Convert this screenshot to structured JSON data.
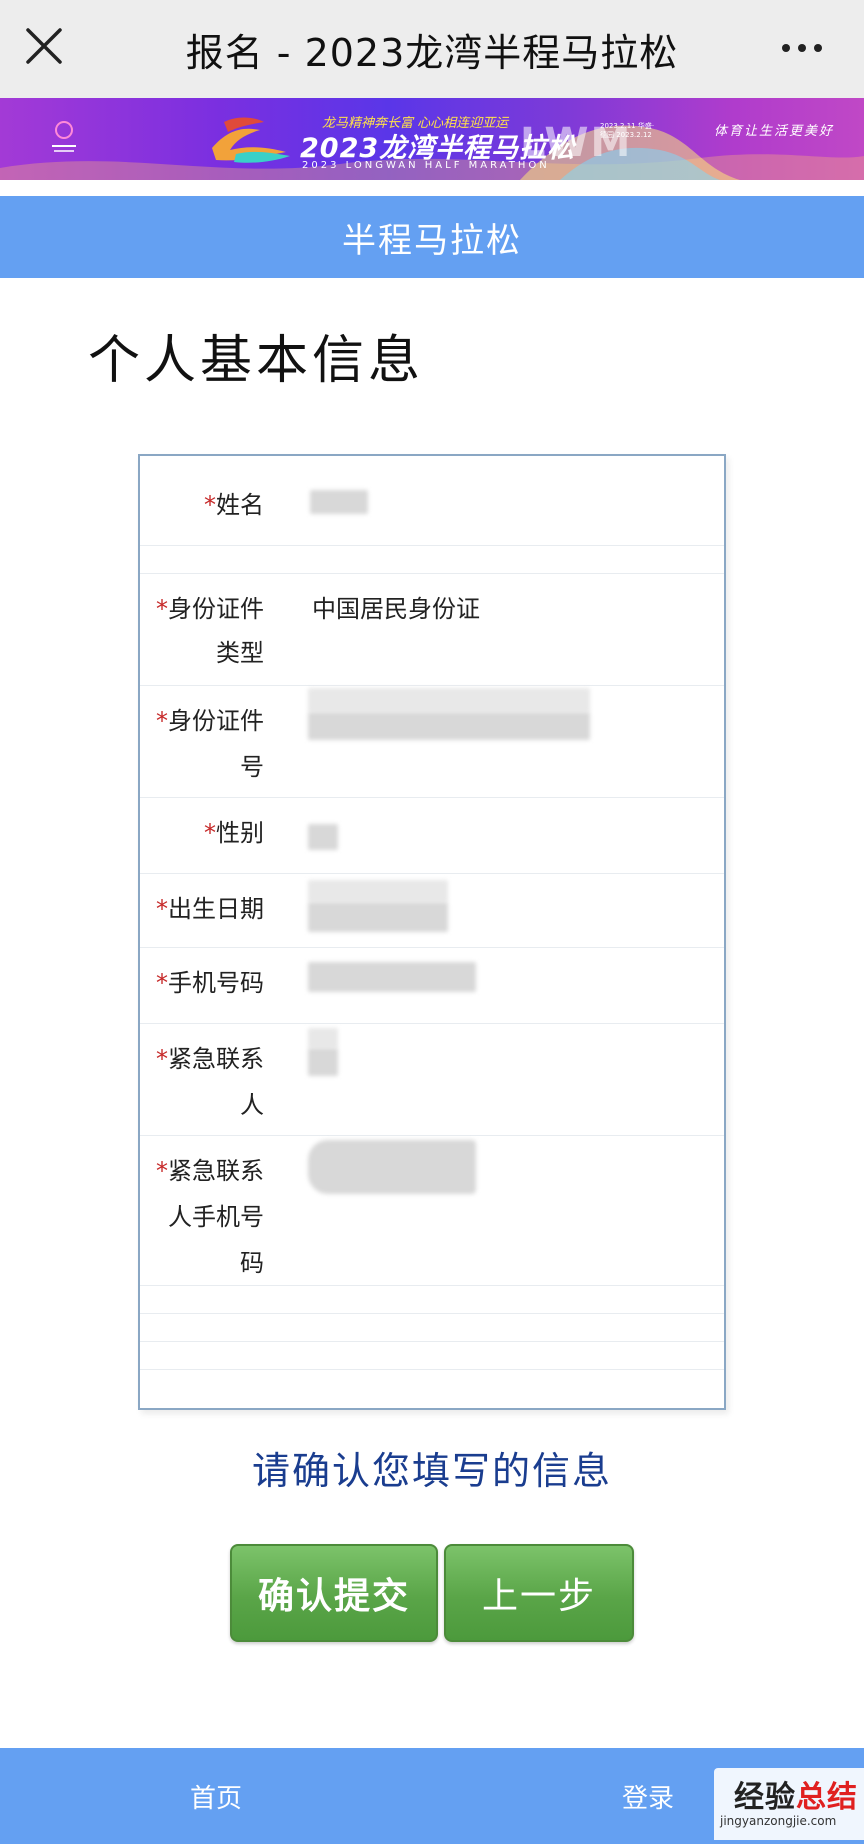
{
  "navbar": {
    "title": "报名 - 2023龙湾半程马拉松",
    "close_icon": "close-icon",
    "more_icon": "more-dots-icon"
  },
  "banner": {
    "slogan_top": "龙马精神奔长富  心心相连迎亚运",
    "main_title": "2023龙湾半程马拉松",
    "sub_title": "2023 LONGWAN HALF MARATHON",
    "lwm": "LWM",
    "date_text": "2023.2.11 华盛·德园 2023.2.12",
    "right_slogan": "体育让生活更美好"
  },
  "section_header": "半程马拉松",
  "page_heading": "个人基本信息",
  "form": {
    "required_mark": "*",
    "rows": [
      {
        "label": "姓名",
        "value": ""
      },
      {
        "label": "身份证件类型",
        "label_line1": "身份证件",
        "label_line2": "类型",
        "value": "中国居民身份证"
      },
      {
        "label": "身份证件号",
        "label_line1": "身份证件",
        "label_line2": "号",
        "value": ""
      },
      {
        "label": "性别",
        "value": ""
      },
      {
        "label": "出生日期",
        "value": ""
      },
      {
        "label": "手机号码",
        "value": ""
      },
      {
        "label": "紧急联系人",
        "label_line1": "紧急联系",
        "label_line2": "人",
        "value": ""
      },
      {
        "label": "紧急联系人手机号码",
        "label_line1": "紧急联系",
        "label_line2": "人手机号",
        "label_line3": "码",
        "value": ""
      }
    ]
  },
  "confirm_text": "请确认您填写的信息",
  "buttons": {
    "submit": "确认提交",
    "back": "上一步"
  },
  "bottom_nav": {
    "home": "首页",
    "login": "登录"
  },
  "watermark": {
    "text_black": "经验",
    "text_red": "总结",
    "url": "jingyanzongjie.com"
  },
  "colors": {
    "accent_blue": "#64a0f2",
    "button_green": "#5aa548",
    "required_red": "#c62828",
    "confirm_text": "#1a3d8f"
  }
}
